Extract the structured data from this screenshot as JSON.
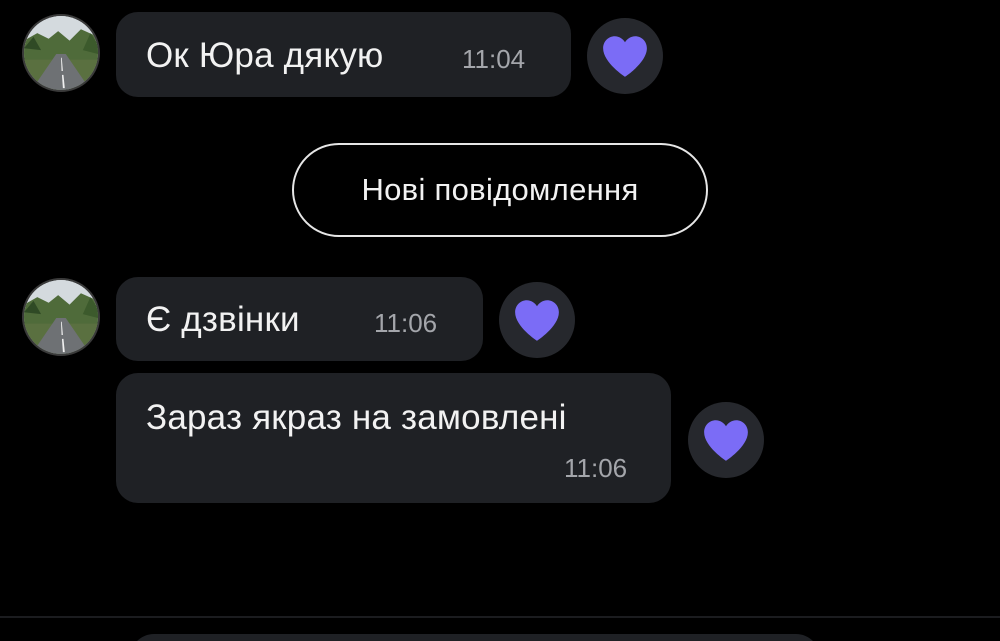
{
  "chat": {
    "divider": {
      "label": "Нові повідомлення"
    },
    "messages": [
      {
        "text": "Ок Юра дякую",
        "time": "11:04",
        "reaction": "heart-icon"
      },
      {
        "text": "Є дзвінки",
        "time": "11:06",
        "reaction": "heart-icon"
      },
      {
        "text": "Зараз якраз на замовлені",
        "time": "11:06",
        "reaction": "heart-icon"
      }
    ]
  },
  "colors": {
    "background": "#000000",
    "bubble": "#1f2125",
    "reaction_bg": "#26282d",
    "heart": "#7b6cf6",
    "timestamp": "#a4a6ab"
  }
}
